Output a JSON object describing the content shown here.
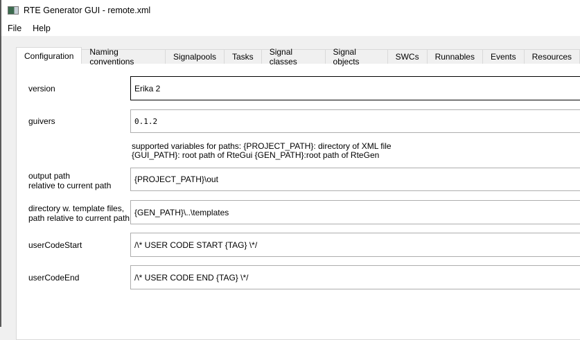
{
  "window": {
    "title": "RTE Generator GUI - remote.xml"
  },
  "menu": [
    "File",
    "Help"
  ],
  "tabs": [
    "Configuration",
    "Naming conventions",
    "Signalpools",
    "Tasks",
    "Signal classes",
    "Signal objects",
    "SWCs",
    "Runnables",
    "Events",
    "Resources"
  ],
  "config": {
    "version": {
      "label": "version",
      "value": "Erika 2"
    },
    "guivers": {
      "label": "guivers",
      "value": "0.1.2"
    },
    "note": [
      "supported variables for paths: {PROJECT_PATH}: directory of XML file",
      "{GUI_PATH}: root path of RteGui {GEN_PATH}:root path of RteGen"
    ],
    "output": {
      "label": [
        "output path",
        "relative to current path"
      ],
      "value": "{PROJECT_PATH}\\out"
    },
    "templates": {
      "label": [
        "directory w. template files,",
        "path relative to current path"
      ],
      "value": "{GEN_PATH}\\..\\templates"
    },
    "start": {
      "label": "userCodeStart",
      "value": "/\\* USER CODE START {TAG} \\*/"
    },
    "end": {
      "label": "userCodeEnd",
      "value": "/\\* USER CODE END {TAG} \\*/"
    }
  }
}
